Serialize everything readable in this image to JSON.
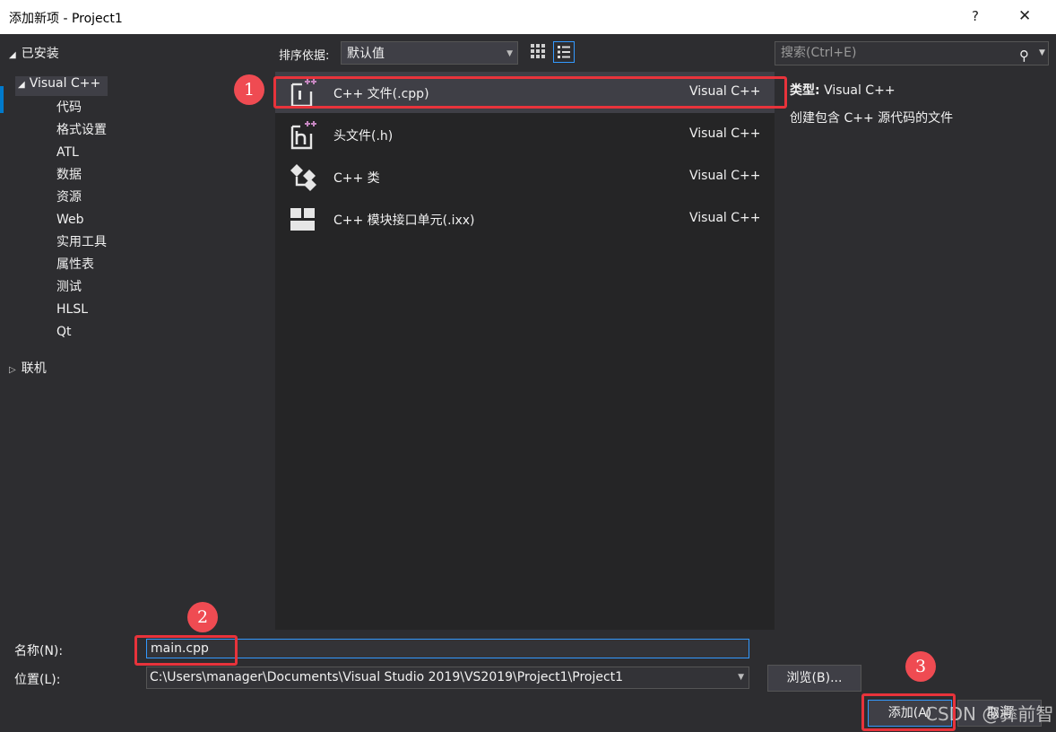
{
  "window": {
    "title": "添加新项 - Project1",
    "help_label": "?",
    "close_label": "✕"
  },
  "sidebar": {
    "installed_label": "已安装",
    "visual_cpp_label": "Visual C++",
    "children": [
      "代码",
      "格式设置",
      "ATL",
      "数据",
      "资源",
      "Web",
      "实用工具",
      "属性表",
      "测试",
      "HLSL",
      "Qt"
    ],
    "online_label": "联机"
  },
  "toolbar": {
    "sort_label": "排序依据:",
    "sort_value": "默认值"
  },
  "templates": [
    {
      "name": "C++ 文件(.cpp)",
      "category": "Visual C++",
      "icon": "cpp-file-icon",
      "selected": true
    },
    {
      "name": "头文件(.h)",
      "category": "Visual C++",
      "icon": "header-file-icon",
      "selected": false
    },
    {
      "name": "C++ 类",
      "category": "Visual C++",
      "icon": "cpp-class-icon",
      "selected": false
    },
    {
      "name": "C++ 模块接口单元(.ixx)",
      "category": "Visual C++",
      "icon": "module-interface-icon",
      "selected": false
    }
  ],
  "search": {
    "placeholder": "搜索(Ctrl+E)"
  },
  "details": {
    "type_label": "类型:",
    "type_value": "Visual C++",
    "description": "创建包含 C++ 源代码的文件"
  },
  "form": {
    "name_label": "名称(N):",
    "name_value": "main.cpp",
    "location_label": "位置(L):",
    "location_value": "C:\\Users\\manager\\Documents\\Visual Studio 2019\\VS2019\\Project1\\Project1",
    "browse_label": "浏览(B)...",
    "add_label": "添加(A)",
    "cancel_label": "取消"
  },
  "annotations": {
    "marker_1": "1",
    "marker_2": "2",
    "marker_3": "3",
    "color": "#e8333b"
  },
  "watermark": "CSDN @彝前智"
}
